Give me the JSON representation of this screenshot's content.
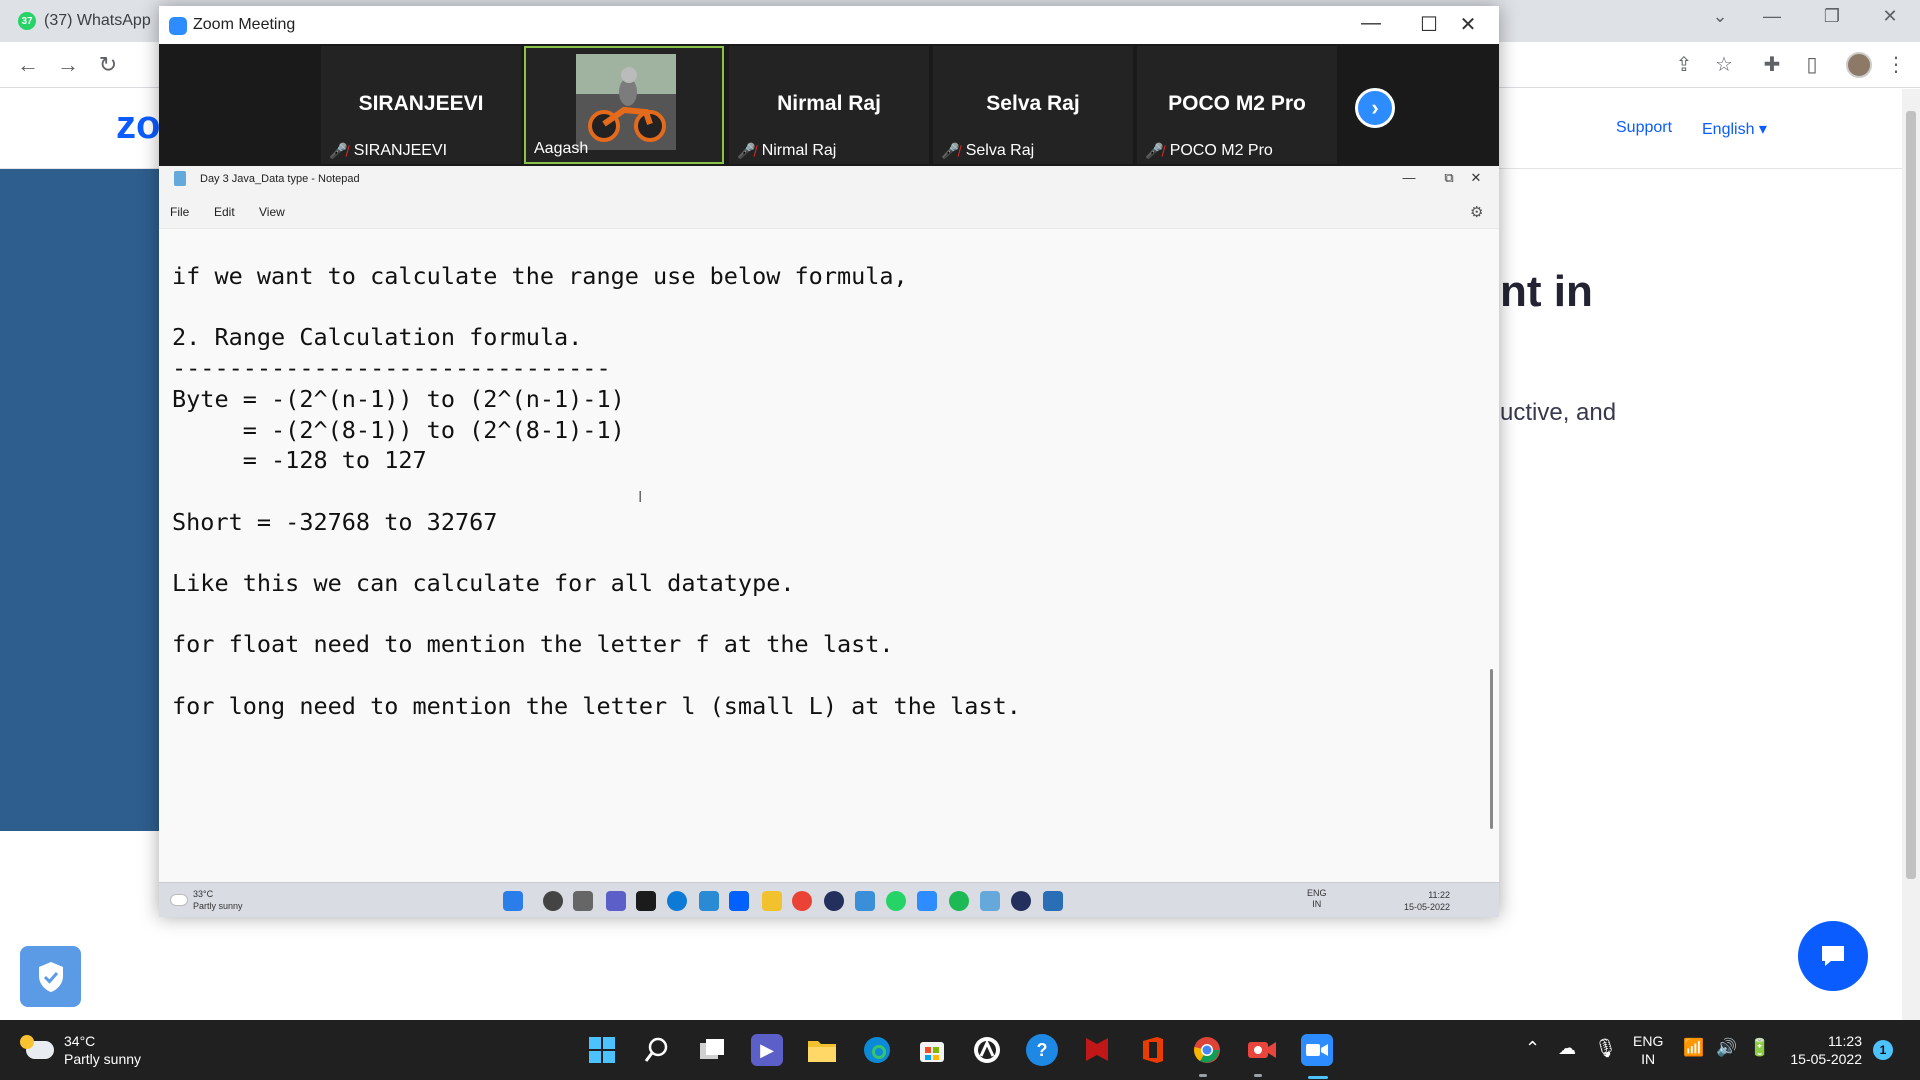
{
  "browser": {
    "tab_label": "(37) WhatsApp",
    "tab_badge": "37",
    "window_controls": {
      "minimize": "—",
      "restore": "❐",
      "close": "✕",
      "tablist": "⌄"
    }
  },
  "zoom_page": {
    "logo": "zo",
    "nav_support": "Support",
    "nav_english": "English ▾",
    "heading_fragment": "nt in",
    "text_fragment": "uctive, and"
  },
  "zoom_window": {
    "title": "Zoom Meeting",
    "controls": {
      "minimize": "—",
      "maximize": "☐",
      "close": "✕"
    },
    "participants": [
      {
        "display": "SIRANJEEVI",
        "label": "SIRANJEEVI",
        "muted": true,
        "video": false
      },
      {
        "display": "",
        "label": "Aagash",
        "muted": false,
        "video": true
      },
      {
        "display": "Nirmal Raj",
        "label": "Nirmal Raj",
        "muted": true,
        "video": false
      },
      {
        "display": "Selva Raj",
        "label": "Selva Raj",
        "muted": true,
        "video": false
      },
      {
        "display": "POCO M2 Pro",
        "label": "POCO M2 Pro",
        "muted": true,
        "video": false
      }
    ],
    "next_icon": "›"
  },
  "notepad": {
    "title": "Day 3 Java_Data type - Notepad",
    "menu": {
      "file": "File",
      "edit": "Edit",
      "view": "View"
    },
    "controls": {
      "minimize": "—",
      "maximize": "⧉",
      "close": "✕"
    },
    "content": "if we want to calculate the range use below formula,\n\n2. Range Calculation formula.\n-------------------------------\nByte = -(2^(n-1)) to (2^(n-1)-1)\n     = -(2^(8-1)) to (2^(8-1)-1)\n     = -128 to 127\n\nShort = -32768 to 32767\n\nLike this we can calculate for all datatype.\n\nfor float need to mention the letter f at the last.\n\nfor long need to mention the letter l (small L) at the last."
  },
  "shared_taskbar": {
    "temp": "33°C",
    "condition": "Partly sunny",
    "lang_top": "ENG",
    "lang_bottom": "IN",
    "time": "11:22",
    "date": "15-05-2022"
  },
  "taskbar": {
    "temp": "34°C",
    "condition": "Partly sunny",
    "lang_top": "ENG",
    "lang_bottom": "IN",
    "time": "11:23",
    "date": "15-05-2022",
    "notification_count": "1"
  }
}
